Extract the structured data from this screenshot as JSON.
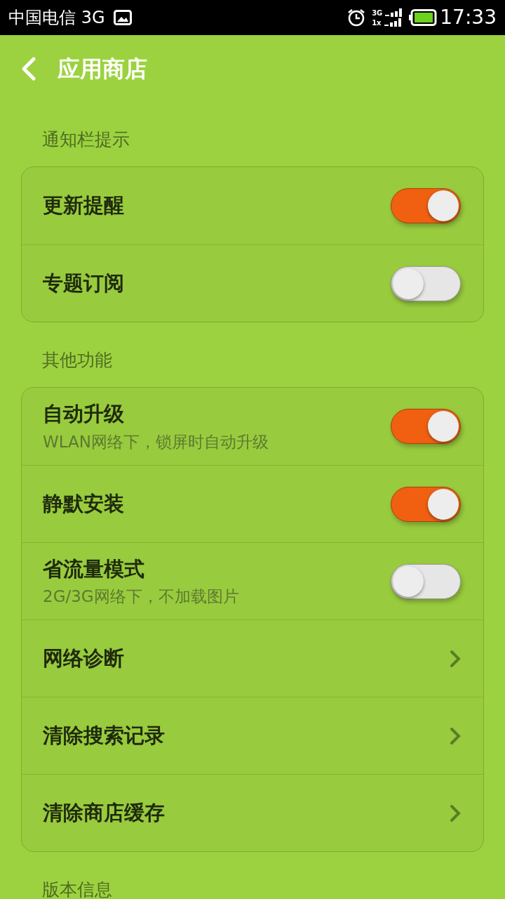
{
  "status_bar": {
    "carrier": "中国电信 3G",
    "net_top": "3G",
    "net_bottom": "1x",
    "time": "17:33"
  },
  "header": {
    "title": "应用商店"
  },
  "sections": [
    {
      "title": "通知栏提示",
      "items": [
        {
          "kind": "switch",
          "label": "更新提醒",
          "on": true
        },
        {
          "kind": "switch",
          "label": "专题订阅",
          "on": false
        }
      ]
    },
    {
      "title": "其他功能",
      "items": [
        {
          "kind": "switch",
          "label": "自动升级",
          "subtitle": "WLAN网络下，锁屏时自动升级",
          "on": true
        },
        {
          "kind": "switch",
          "label": "静默安装",
          "on": true
        },
        {
          "kind": "switch",
          "label": "省流量模式",
          "subtitle": "2G/3G网络下，不加载图片",
          "on": false
        },
        {
          "kind": "link",
          "label": "网络诊断"
        },
        {
          "kind": "link",
          "label": "清除搜索记录"
        },
        {
          "kind": "link",
          "label": "清除商店缓存"
        }
      ]
    },
    {
      "title": "版本信息"
    }
  ]
}
